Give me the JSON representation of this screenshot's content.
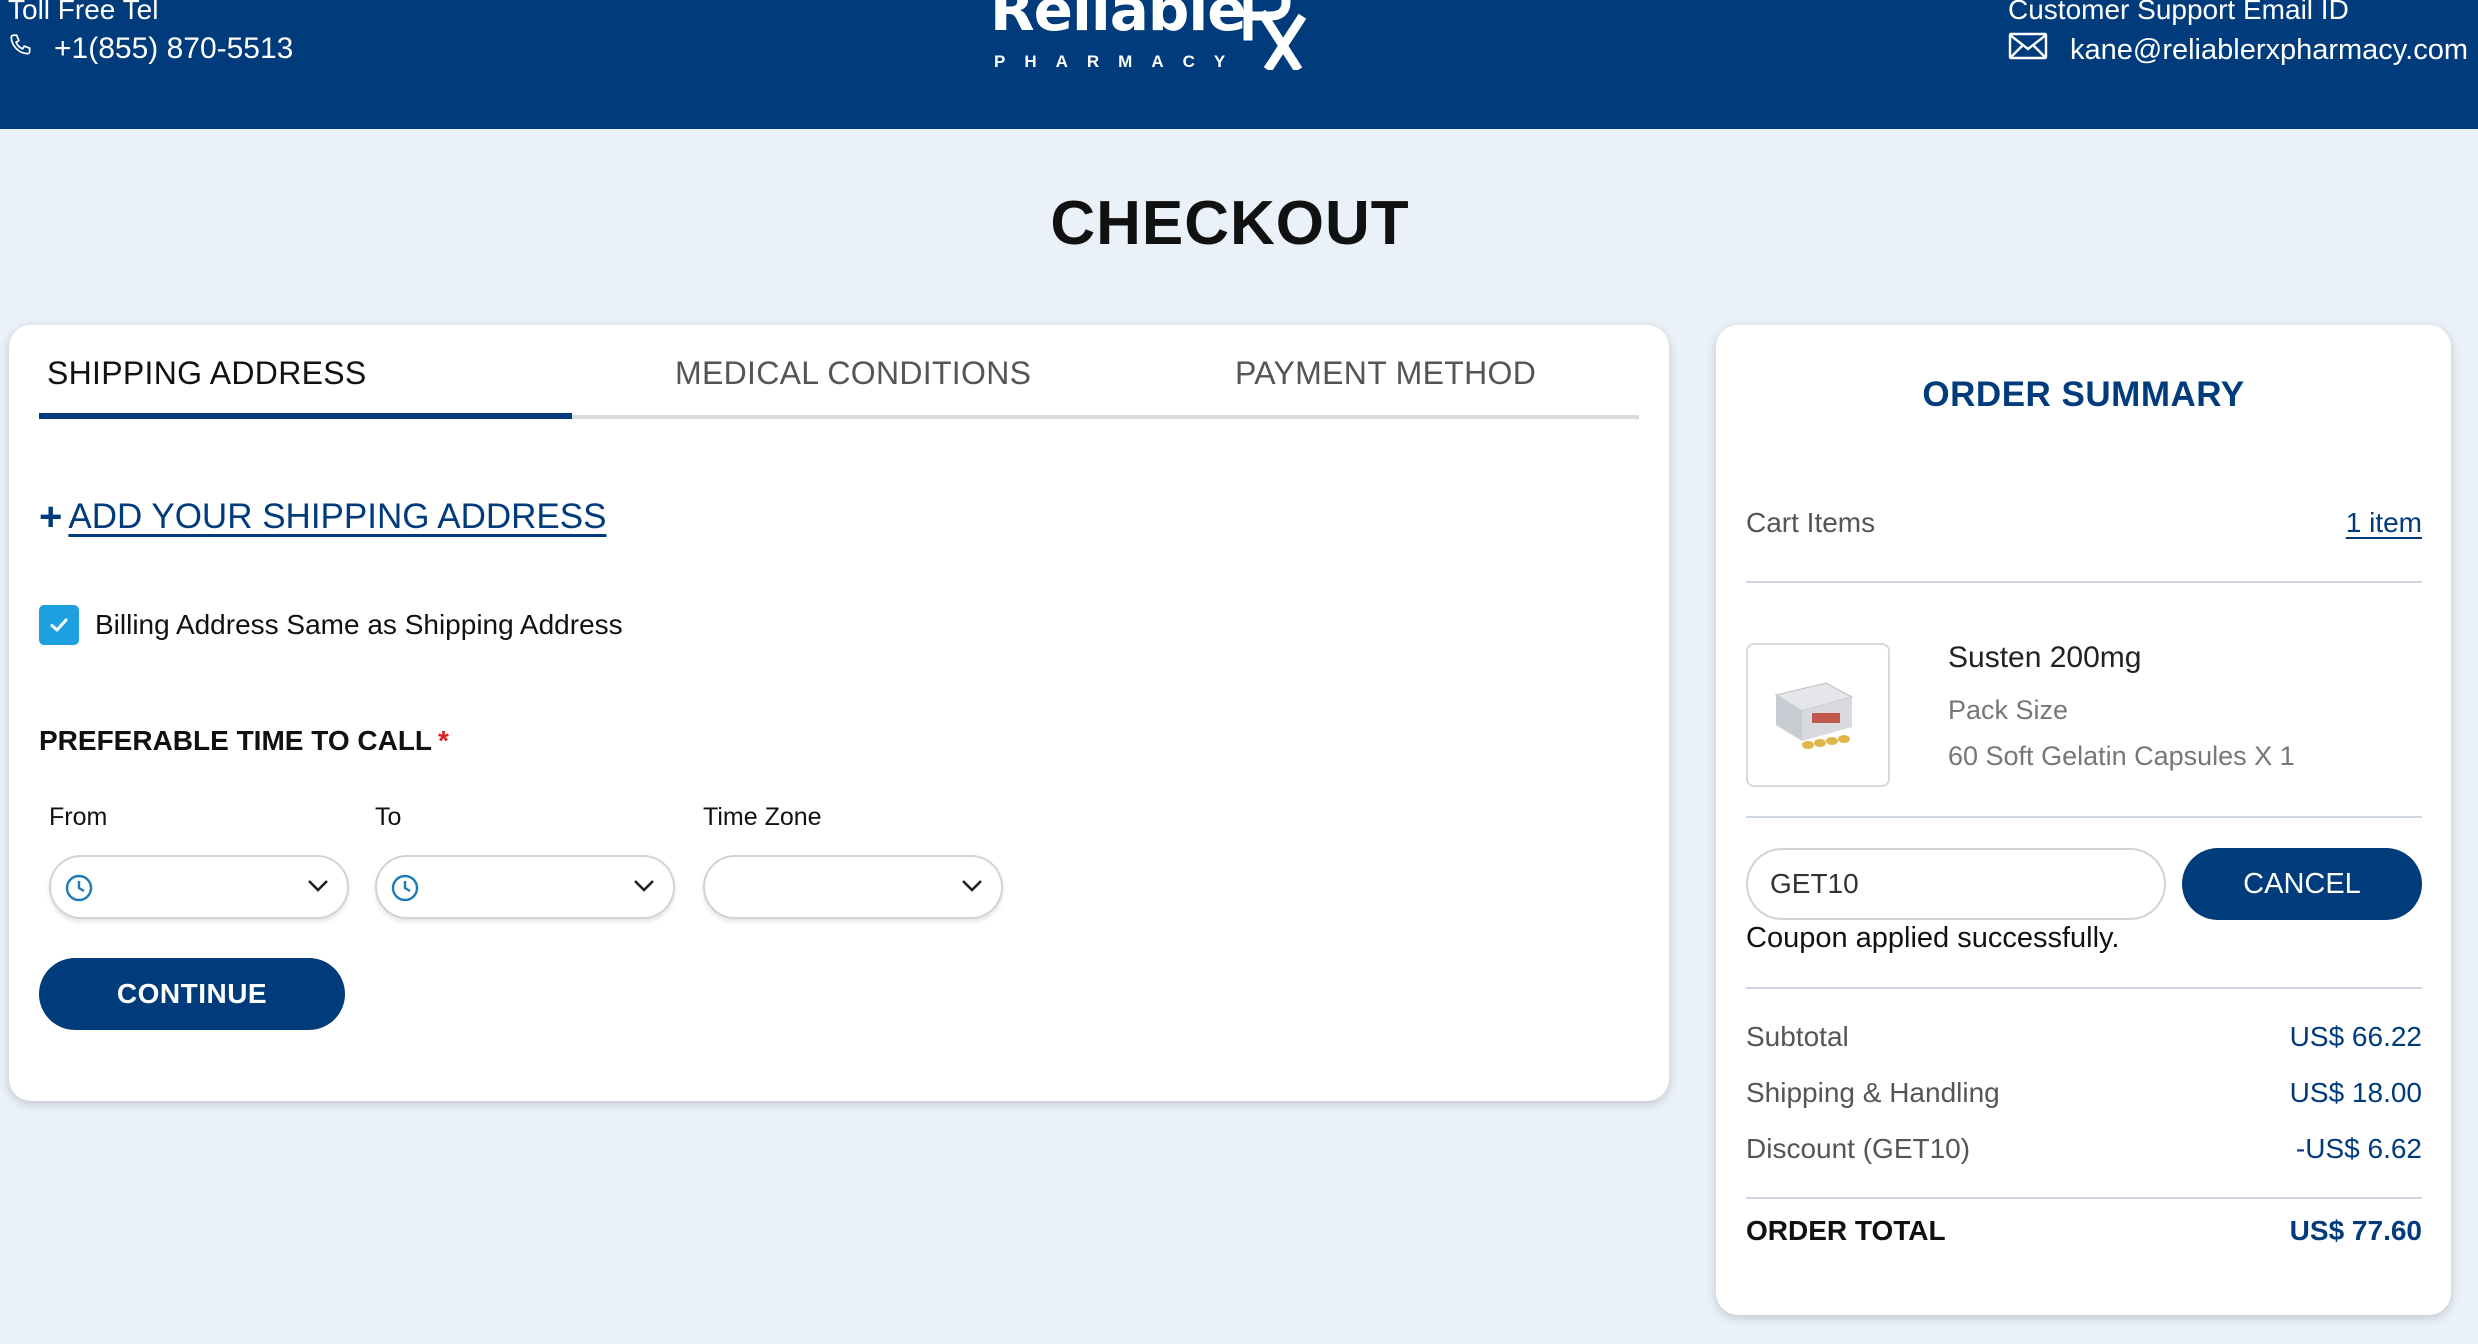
{
  "header": {
    "tel_label": "Toll Free Tel",
    "tel_number": "+1(855) 870-5513",
    "email_label": "Customer Support Email ID",
    "email": "kane@reliablerxpharmacy.com",
    "logo_word": "Reliable",
    "logo_rx": "Rx",
    "logo_sub": "PHARMACY"
  },
  "page": {
    "title": "CHECKOUT"
  },
  "tabs": [
    {
      "label": "SHIPPING ADDRESS",
      "active": true
    },
    {
      "label": "MEDICAL CONDITIONS",
      "active": false
    },
    {
      "label": "PAYMENT METHOD",
      "active": false
    }
  ],
  "shipping": {
    "add_address_plus": "+",
    "add_address_label": "ADD YOUR SHIPPING ADDRESS",
    "billing_same_label": "Billing Address Same as Shipping Address",
    "billing_same_checked": true,
    "call_title": "PREFERABLE TIME TO CALL",
    "required_mark": "*",
    "from_label": "From",
    "to_label": "To",
    "timezone_label": "Time Zone",
    "continue_label": "CONTINUE"
  },
  "summary": {
    "title": "ORDER SUMMARY",
    "cart_items_label": "Cart Items",
    "cart_items_count": "1 item",
    "product": {
      "name": "Susten 200mg",
      "pack_size_label": "Pack Size",
      "pack_size_value": "60 Soft Gelatin Capsules X 1"
    },
    "coupon": {
      "value": "GET10",
      "cancel_label": "CANCEL",
      "message": "Coupon applied successfully."
    },
    "lines": [
      {
        "label": "Subtotal",
        "value": "US$ 66.22"
      },
      {
        "label": "Shipping & Handling",
        "value": "US$ 18.00"
      },
      {
        "label": "Discount (GET10)",
        "value": "-US$ 6.62"
      }
    ],
    "total_label": "ORDER TOTAL",
    "total_value": "US$ 77.60"
  },
  "colors": {
    "brand": "#003b7c",
    "page_bg": "#eaf1f8",
    "checkbox": "#1e9fe0",
    "required": "#e02020"
  },
  "icons": [
    "phone-icon",
    "mail-icon",
    "check-icon",
    "clock-icon",
    "chevron-down-icon",
    "product-image"
  ]
}
